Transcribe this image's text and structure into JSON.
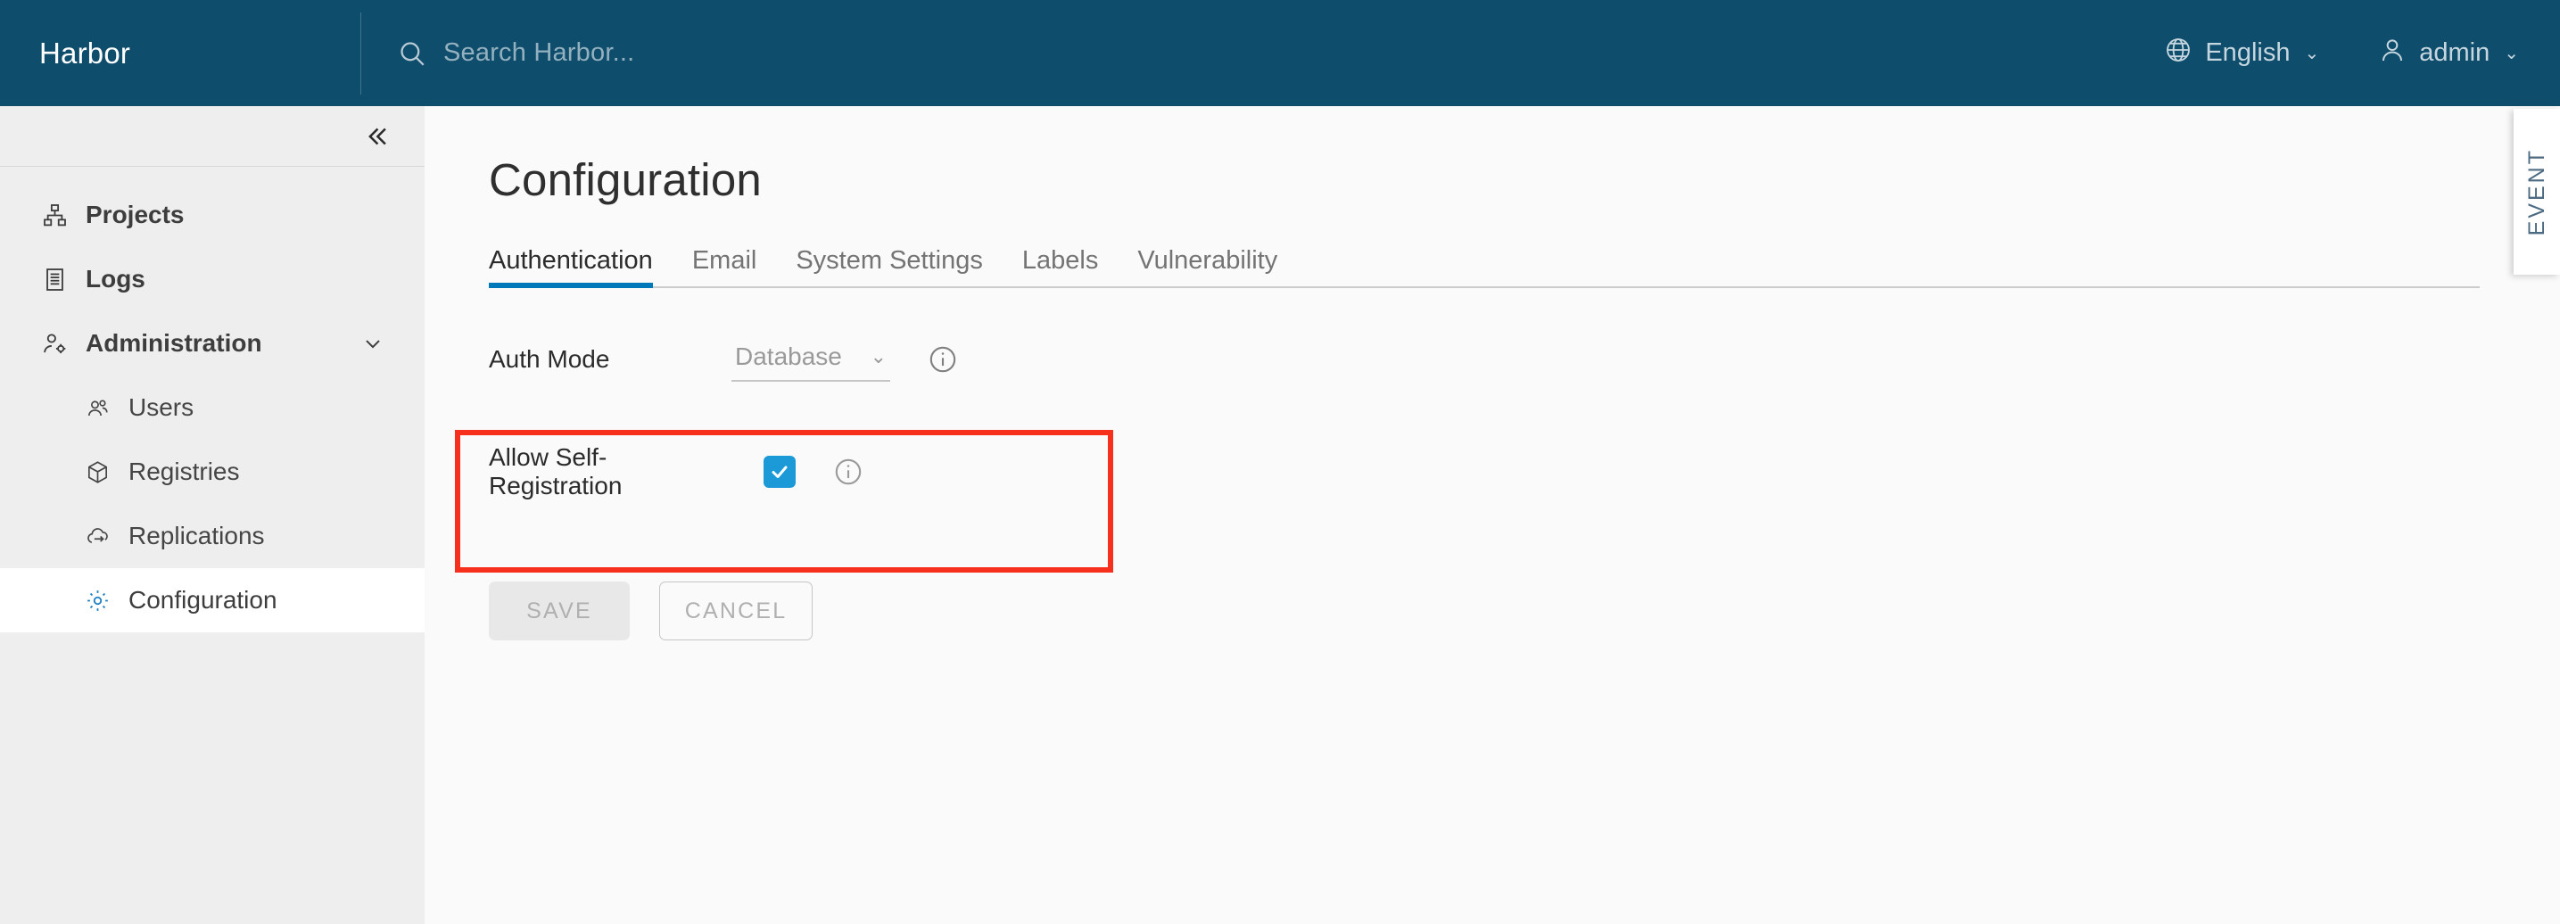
{
  "header": {
    "brand": "Harbor",
    "search": {
      "placeholder": "Search Harbor...",
      "value": "",
      "icon": "search-icon"
    },
    "language": {
      "label": "English",
      "icon": "globe-icon",
      "caret": "⌄"
    },
    "user": {
      "label": "admin",
      "icon": "user-icon",
      "caret": "⌄"
    }
  },
  "sidebar": {
    "collapse_icon": "double-chevron-left-icon",
    "items": [
      {
        "label": "Projects",
        "icon": "projects-icon",
        "level": "top",
        "active": false
      },
      {
        "label": "Logs",
        "icon": "logs-icon",
        "level": "top",
        "active": false
      },
      {
        "label": "Administration",
        "icon": "administration-icon",
        "level": "top",
        "active": false,
        "expanded": true,
        "chevron": "chevron-down-icon"
      },
      {
        "label": "Users",
        "icon": "users-icon",
        "level": "sub",
        "active": false
      },
      {
        "label": "Registries",
        "icon": "registries-icon",
        "level": "sub",
        "active": false
      },
      {
        "label": "Replications",
        "icon": "replications-icon",
        "level": "sub",
        "active": false
      },
      {
        "label": "Configuration",
        "icon": "gear-icon",
        "level": "sub",
        "active": true
      }
    ]
  },
  "main": {
    "title": "Configuration",
    "tabs": [
      {
        "label": "Authentication",
        "active": true
      },
      {
        "label": "Email",
        "active": false
      },
      {
        "label": "System Settings",
        "active": false
      },
      {
        "label": "Labels",
        "active": false
      },
      {
        "label": "Vulnerability",
        "active": false
      }
    ],
    "form": {
      "auth_mode": {
        "label": "Auth Mode",
        "value": "Database",
        "caret": "⌄",
        "disabled": true,
        "info_icon": "info-icon"
      },
      "allow_self_registration": {
        "label": "Allow Self-Registration",
        "checked": true,
        "info_icon": "info-icon",
        "highlighted": true,
        "highlight_color": "#f7301e"
      }
    },
    "buttons": {
      "save": {
        "label": "SAVE",
        "disabled": true
      },
      "cancel": {
        "label": "CANCEL",
        "disabled": true
      }
    }
  },
  "event_panel": {
    "label": "EVENT"
  },
  "colors": {
    "header_bg": "#0f4d6d",
    "sidebar_bg": "#eeeeee",
    "content_bg": "#fafafa",
    "accent_blue": "#0079b8",
    "checkbox_blue": "#1b9ad7",
    "highlight_red": "#f7301e"
  }
}
